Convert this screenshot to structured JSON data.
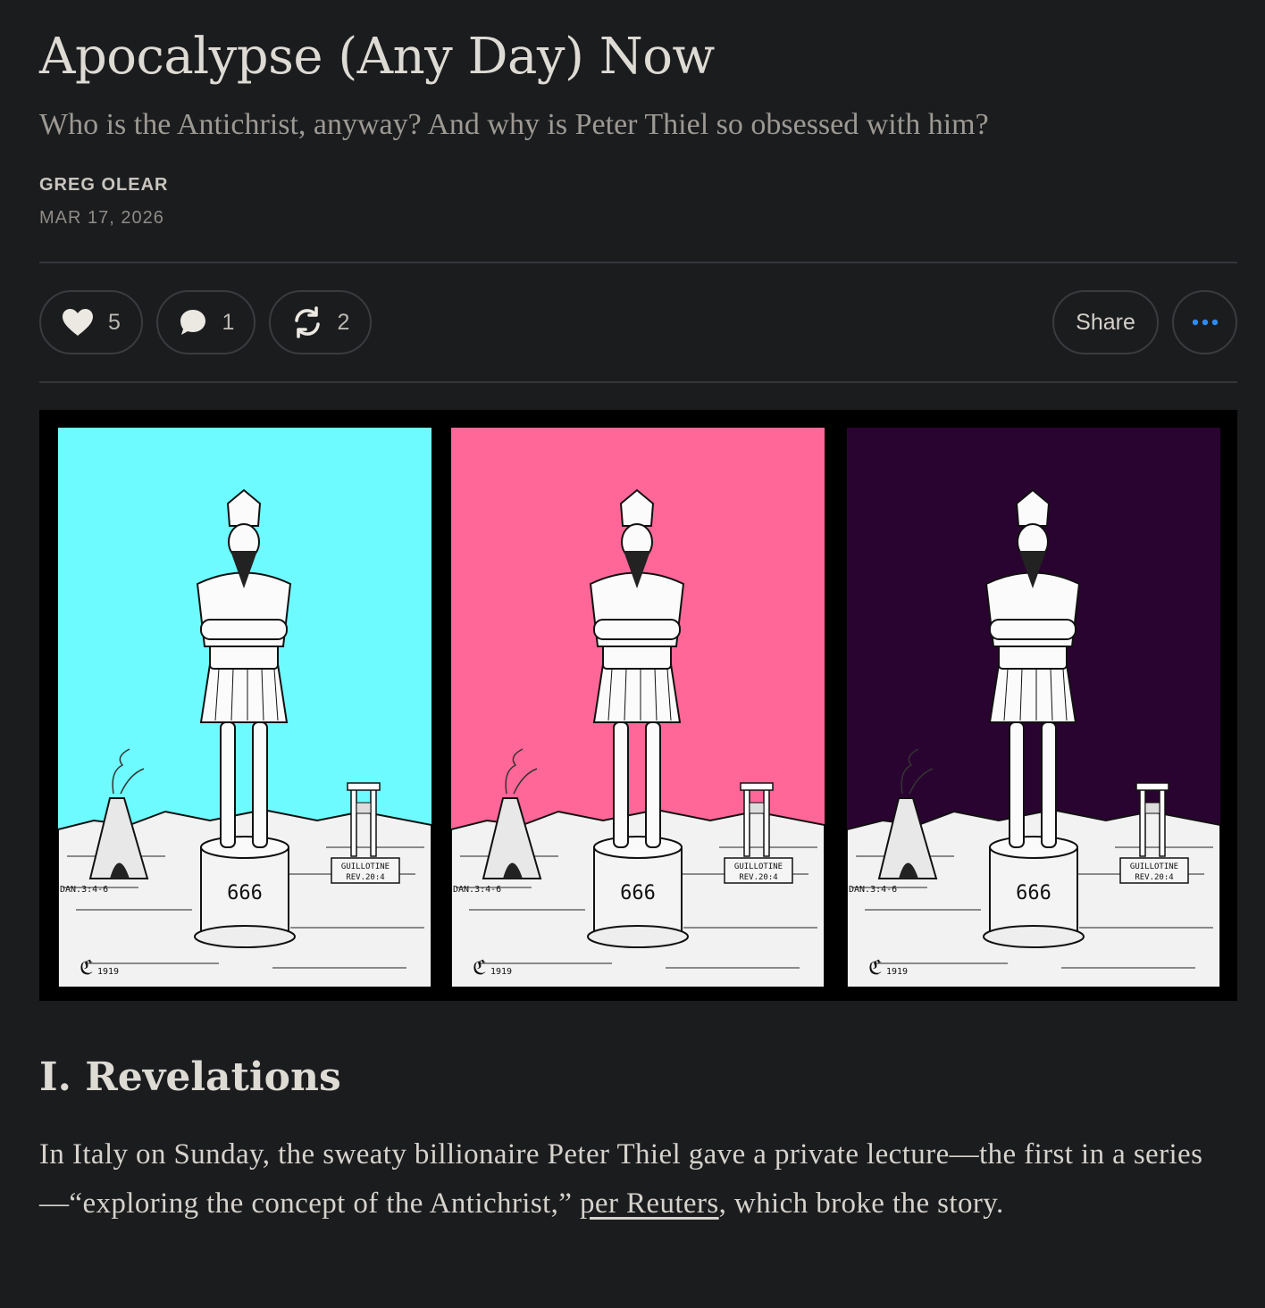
{
  "article": {
    "title": "Apocalypse (Any Day) Now",
    "subtitle": "Who is the Antichrist, anyway? And why is Peter Thiel so obsessed with him?",
    "author": "GREG OLEAR",
    "date": "MAR 17, 2026"
  },
  "actions": {
    "likes": "5",
    "comments": "1",
    "restacks": "2",
    "share_label": "Share",
    "icons": [
      "heart-icon",
      "comment-icon",
      "restack-icon",
      "more-icon"
    ],
    "more_color": "#2f8cf5"
  },
  "figure": {
    "panel_colors": [
      "#6efbff",
      "#ff6798",
      "#2a0430"
    ],
    "pedestal_text": "666",
    "sign_line1": "GUILLOTINE",
    "sign_line2": "REV.20:4",
    "verse_label": "DAN.3:4-6",
    "signature": "1919"
  },
  "section": {
    "heading": "I. Revelations",
    "paragraph_before": "In Italy on Sunday, the sweaty billionaire Peter Thiel gave a private lecture—the first in a series—“exploring the concept of the Antichrist,” ",
    "link_text": "per Reuters",
    "paragraph_after": ", which broke the story."
  }
}
